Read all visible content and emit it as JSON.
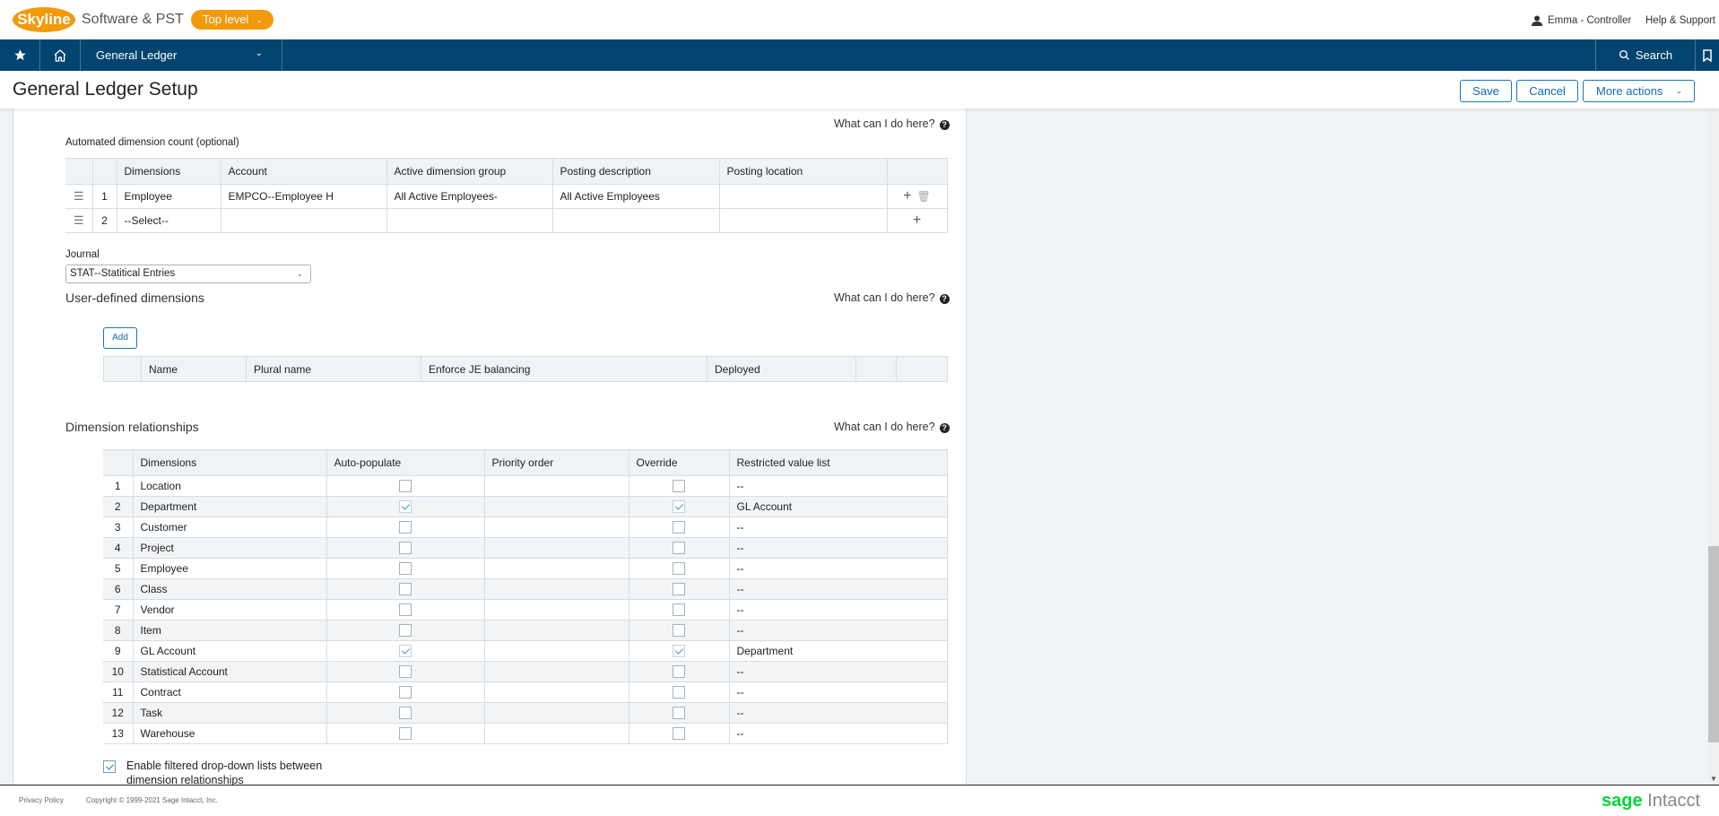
{
  "topbar": {
    "logo": "Skyline",
    "company": "Software & PST",
    "level_button": "Top level",
    "user": "Emma - Controller",
    "help": "Help & Support"
  },
  "nav": {
    "module": "General Ledger",
    "search": "Search"
  },
  "page": {
    "title": "General Ledger Setup",
    "save": "Save",
    "cancel": "Cancel",
    "more_actions": "More actions"
  },
  "help_link": "What can I do here?",
  "adc": {
    "label": "Automated dimension count (optional)",
    "columns": [
      "Dimensions",
      "Account",
      "Active dimension group",
      "Posting description",
      "Posting location"
    ],
    "rows": [
      {
        "num": "1",
        "dimension": "Employee",
        "account": "EMPCO--Employee H",
        "group": "All Active Employees-",
        "description": "All Active Employees",
        "location": ""
      },
      {
        "num": "2",
        "dimension": "--Select--",
        "account": "",
        "group": "",
        "description": "",
        "location": ""
      }
    ]
  },
  "journal": {
    "label": "Journal",
    "value": "STAT--Statitical Entries"
  },
  "udd": {
    "title": "User-defined dimensions",
    "add": "Add",
    "columns": [
      "Name",
      "Plural name",
      "Enforce JE balancing",
      "Deployed"
    ]
  },
  "dr": {
    "title": "Dimension relationships",
    "columns": [
      "Dimensions",
      "Auto-populate",
      "Priority order",
      "Override",
      "Restricted value list"
    ],
    "rows": [
      {
        "num": "1",
        "name": "Location",
        "auto": false,
        "priority": "",
        "override": false,
        "restricted": "--"
      },
      {
        "num": "2",
        "name": "Department",
        "auto": true,
        "priority": "",
        "override": true,
        "restricted": "GL Account"
      },
      {
        "num": "3",
        "name": "Customer",
        "auto": false,
        "priority": "",
        "override": false,
        "restricted": "--"
      },
      {
        "num": "4",
        "name": "Project",
        "auto": false,
        "priority": "",
        "override": false,
        "restricted": "--"
      },
      {
        "num": "5",
        "name": "Employee",
        "auto": false,
        "priority": "",
        "override": false,
        "restricted": "--"
      },
      {
        "num": "6",
        "name": "Class",
        "auto": false,
        "priority": "",
        "override": false,
        "restricted": "--"
      },
      {
        "num": "7",
        "name": "Vendor",
        "auto": false,
        "priority": "",
        "override": false,
        "restricted": "--"
      },
      {
        "num": "8",
        "name": "Item",
        "auto": false,
        "priority": "",
        "override": false,
        "restricted": "--"
      },
      {
        "num": "9",
        "name": "GL Account",
        "auto": true,
        "priority": "",
        "override": true,
        "restricted": "Department"
      },
      {
        "num": "10",
        "name": "Statistical Account",
        "auto": false,
        "priority": "",
        "override": false,
        "restricted": "--"
      },
      {
        "num": "11",
        "name": "Contract",
        "auto": false,
        "priority": "",
        "override": false,
        "restricted": "--"
      },
      {
        "num": "12",
        "name": "Task",
        "auto": false,
        "priority": "",
        "override": false,
        "restricted": "--"
      },
      {
        "num": "13",
        "name": "Warehouse",
        "auto": false,
        "priority": "",
        "override": false,
        "restricted": "--"
      }
    ],
    "enable_filtered": {
      "checked": true,
      "label": "Enable filtered drop-down lists between dimension relationships"
    }
  },
  "footer": {
    "privacy": "Privacy Policy",
    "copyright": "Copyright © 1999-2021 Sage Intacct, Inc.",
    "brand_sage": "sage",
    "brand_intacct": "Intacct"
  },
  "colors": {
    "nav_bg": "#00446f",
    "brand_orange": "#f29a0c",
    "button_blue": "#1268b3",
    "sage_green": "#00d639"
  }
}
